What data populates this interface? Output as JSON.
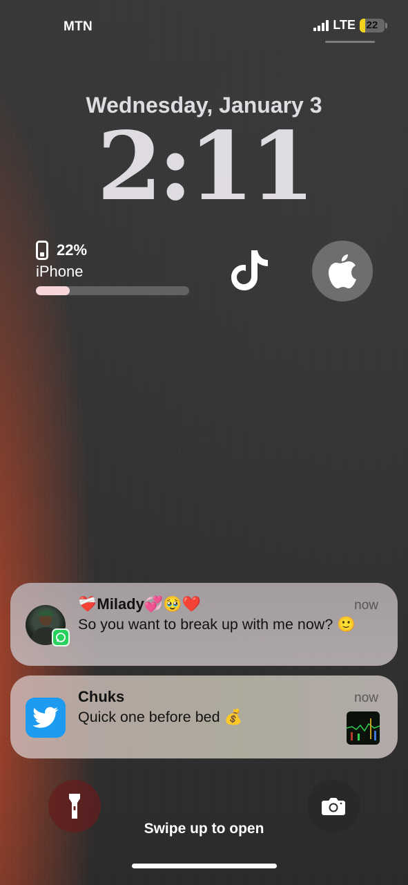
{
  "status_bar": {
    "carrier": "MTN",
    "network": "LTE",
    "battery_level": "22",
    "battery_fraction": 0.22,
    "battery_color": "#f2d21c"
  },
  "lock_screen": {
    "date": "Wednesday, January 3",
    "time": "2:11"
  },
  "widgets": {
    "battery": {
      "percent_label": "22%",
      "device": "iPhone",
      "level_fraction": 0.22,
      "bar_color": "#f7d6da",
      "icon": "iphone-icon"
    },
    "tiktok": {
      "icon": "tiktok-icon"
    },
    "apple": {
      "icon": "apple-logo-icon"
    }
  },
  "notifications": [
    {
      "app": "WhatsApp",
      "app_icon": "whatsapp-badge-icon",
      "title": "❤️‍🩹Milady💞🥹❤️",
      "body": "So you want to break up with me now? 🙂",
      "time": "now"
    },
    {
      "app": "Twitter",
      "app_icon": "twitter-bird-icon",
      "title": "Chuks",
      "body": "Quick one before bed 💰",
      "time": "now",
      "accent_color": "#1d9bf0"
    }
  ],
  "bottom": {
    "flashlight_icon": "flashlight-icon",
    "camera_icon": "camera-icon",
    "swipe_hint": "Swipe up to open"
  }
}
